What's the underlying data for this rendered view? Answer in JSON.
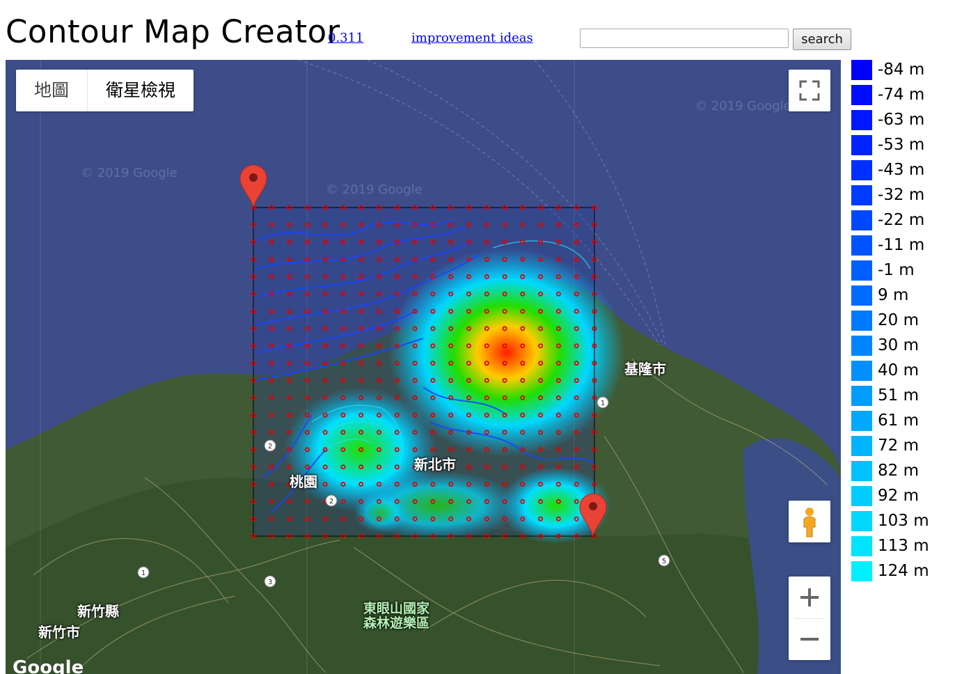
{
  "app": {
    "title": "Contour Map Creator",
    "version_link": "0.311",
    "ideas_link": "improvement ideas"
  },
  "search": {
    "placeholder": "",
    "value": "",
    "button_label": "search"
  },
  "map": {
    "type_tabs": [
      {
        "label": "地圖",
        "active": false
      },
      {
        "label": "衛星檢視",
        "active": true
      }
    ],
    "labels": {
      "keelung": "基隆市",
      "new_taipei": "新北市",
      "taoyuan": "桃園",
      "hsinchu_county": "新竹縣",
      "hsinchu_city": "新竹市",
      "forest_park": "東眼山國家\n森林遊樂區"
    },
    "watermark": "© 2019 Google",
    "logo": "Google",
    "road_shields": [
      "1",
      "2",
      "2",
      "1",
      "3",
      "5"
    ]
  },
  "legend": [
    {
      "label": "-84 m",
      "color": "#0000ff"
    },
    {
      "label": "-74 m",
      "color": "#000cff"
    },
    {
      "label": "-63 m",
      "color": "#0018ff"
    },
    {
      "label": "-53 m",
      "color": "#0024ff"
    },
    {
      "label": "-43 m",
      "color": "#0030ff"
    },
    {
      "label": "-32 m",
      "color": "#003cff"
    },
    {
      "label": "-22 m",
      "color": "#0048ff"
    },
    {
      "label": "-11 m",
      "color": "#0054ff"
    },
    {
      "label": "-1 m",
      "color": "#0060ff"
    },
    {
      "label": "9 m",
      "color": "#006cff"
    },
    {
      "label": "20 m",
      "color": "#0078ff"
    },
    {
      "label": "30 m",
      "color": "#0084ff"
    },
    {
      "label": "40 m",
      "color": "#0090ff"
    },
    {
      "label": "51 m",
      "color": "#009cff"
    },
    {
      "label": "61 m",
      "color": "#00a8ff"
    },
    {
      "label": "72 m",
      "color": "#00b4ff"
    },
    {
      "label": "82 m",
      "color": "#00c0ff"
    },
    {
      "label": "92 m",
      "color": "#00ccff"
    },
    {
      "label": "103 m",
      "color": "#00d8ff"
    },
    {
      "label": "113 m",
      "color": "#00e4ff"
    },
    {
      "label": "124 m",
      "color": "#00f0ff"
    }
  ],
  "colors": {
    "sea": "#3a4a85",
    "land": "#3f5a34",
    "marker": "#ea4335",
    "grid_point": "#e00000"
  }
}
